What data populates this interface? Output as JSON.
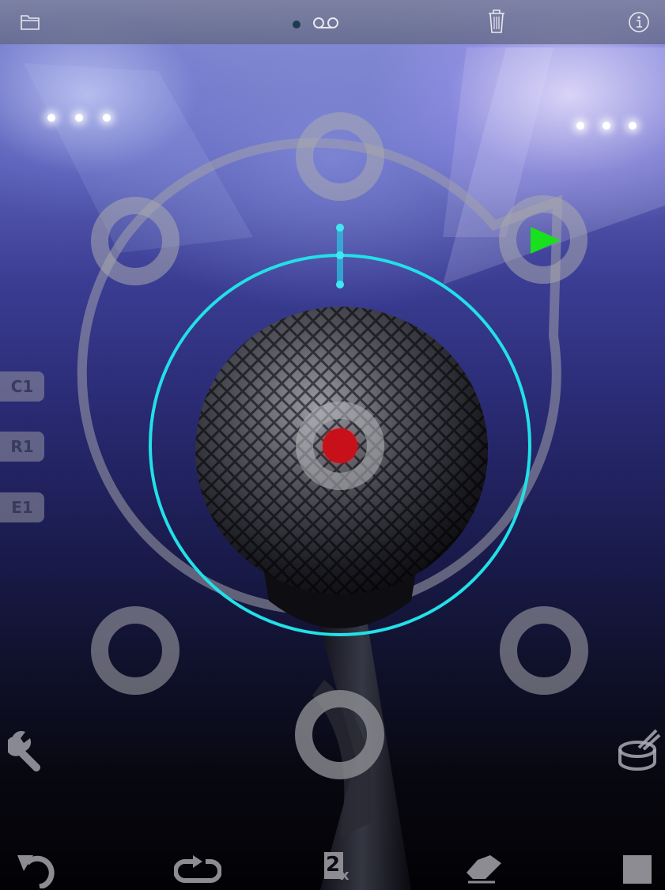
{
  "side_buttons": [
    "C1",
    "R1",
    "E1"
  ],
  "toolbar_top": [
    "folder-icon",
    "voicemail-icon",
    "trash-icon",
    "info-icon"
  ],
  "toolbar_bottom": [
    "undo-icon",
    "loop-icon",
    "double-speed-icon",
    "eraser-icon",
    "stop-icon"
  ],
  "bottom_tools": [
    "wrench-icon",
    "drum-icon"
  ],
  "double_speed": {
    "digit": "2",
    "sub": "x"
  },
  "colors": {
    "accent": "#22e0e8",
    "play": "#19e01e",
    "record": "#c8101a"
  }
}
